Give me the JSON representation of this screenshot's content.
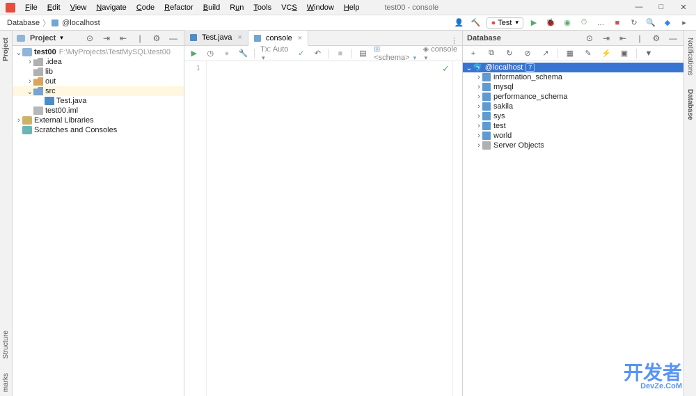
{
  "window": {
    "title": "test00 - console"
  },
  "menu": [
    "File",
    "Edit",
    "View",
    "Navigate",
    "Code",
    "Refactor",
    "Build",
    "Run",
    "Tools",
    "VCS",
    "Window",
    "Help"
  ],
  "breadcrumb": {
    "items": [
      "Database",
      "@localhost"
    ]
  },
  "runConfig": {
    "label": "Test"
  },
  "projectPanel": {
    "title": "Project",
    "tree": {
      "root": {
        "name": "test00",
        "path": "F:\\MyProjects\\TestMySQL\\test00"
      },
      "children": [
        {
          "name": ".idea",
          "type": "folder"
        },
        {
          "name": "lib",
          "type": "folder"
        },
        {
          "name": "out",
          "type": "folder-orange",
          "expanded": false
        },
        {
          "name": "src",
          "type": "folder-blue",
          "expanded": true,
          "selected": true,
          "children": [
            {
              "name": "Test.java",
              "type": "java"
            }
          ]
        },
        {
          "name": "test00.iml",
          "type": "file"
        }
      ],
      "extLibs": "External Libraries",
      "scratches": "Scratches and Consoles"
    }
  },
  "editor": {
    "tabs": [
      {
        "label": "Test.java",
        "active": false
      },
      {
        "label": "console",
        "active": true
      }
    ],
    "toolbar": {
      "txAuto": "Tx: Auto",
      "schema": "<schema>",
      "console": "console"
    },
    "lineNumber": "1"
  },
  "dbPanel": {
    "title": "Database",
    "root": {
      "name": "@localhost",
      "count": "7"
    },
    "schemas": [
      "information_schema",
      "mysql",
      "performance_schema",
      "sakila",
      "sys",
      "test",
      "world"
    ],
    "serverObjects": "Server Objects"
  },
  "leftGutter": {
    "project": "Project",
    "structure": "Structure",
    "marks": "marks"
  },
  "rightGutter": {
    "notifications": "Notifications",
    "database": "Database"
  },
  "watermark": {
    "ch": "开发者",
    "en": "DevZe.CoM"
  }
}
